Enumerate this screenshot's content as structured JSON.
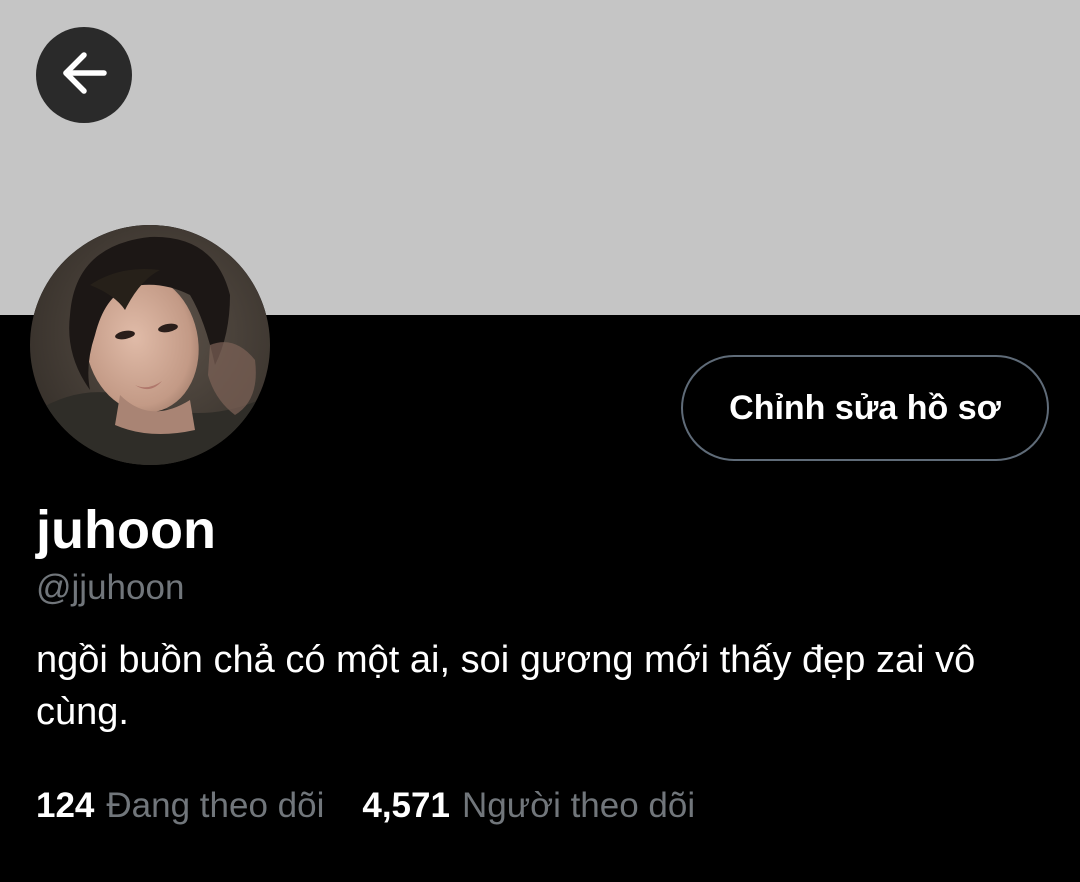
{
  "colors": {
    "background": "#000000",
    "banner": "#c5c5c5",
    "primary_text": "#ffffff",
    "secondary_text": "#71767b",
    "button_border": "#5f6b78"
  },
  "header": {
    "back_icon": "arrow-left-icon"
  },
  "profile": {
    "edit_button_label": "Chỉnh sửa hồ sơ",
    "display_name": "juhoon",
    "handle": "@jjuhoon",
    "bio": "ngồi buồn chả có một ai, soi gương mới thấy đẹp zai vô cùng."
  },
  "stats": {
    "following_count": "124",
    "following_label": "Đang theo dõi",
    "followers_count": "4,571",
    "followers_label": "Người theo dõi"
  }
}
